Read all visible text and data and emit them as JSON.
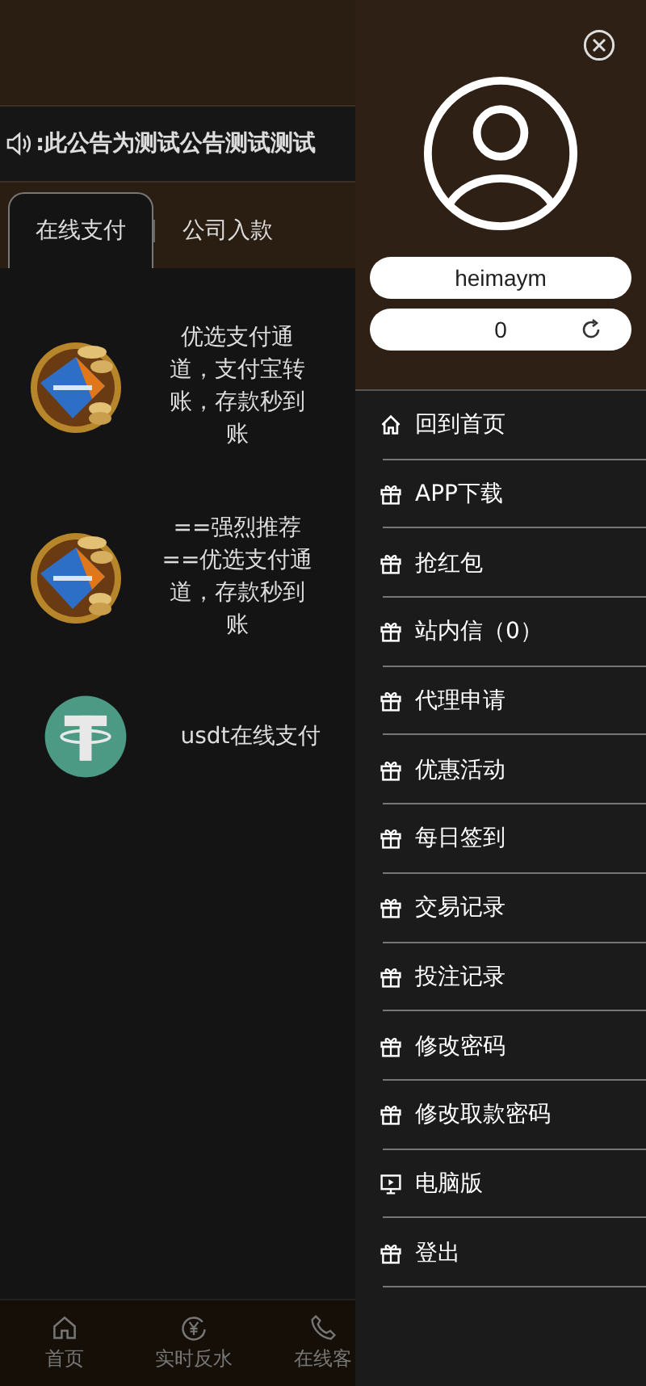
{
  "notice": {
    "text": ":此公告为测试公告测试测试"
  },
  "tabs": [
    {
      "label": "在线支付",
      "selected": true
    },
    {
      "label": "公司入款",
      "selected": false
    }
  ],
  "payments": [
    {
      "kind": "alipay",
      "label": "优选支付通道，支付宝转账，存款秒到账"
    },
    {
      "kind": "alipay",
      "label": "==强烈推荐==优选支付通道，存款秒到账"
    },
    {
      "kind": "usdt",
      "label": "usdt在线支付"
    }
  ],
  "bottom_nav": [
    {
      "kind": "home",
      "label": "首页"
    },
    {
      "kind": "yen",
      "label": "实时反水"
    },
    {
      "kind": "phone",
      "label": "在线客"
    }
  ],
  "drawer": {
    "username": "heimaym",
    "balance": "0",
    "menu": [
      {
        "kind": "home",
        "label": "回到首页"
      },
      {
        "kind": "gift",
        "label": "APP下载"
      },
      {
        "kind": "gift",
        "label": "抢红包"
      },
      {
        "kind": "gift",
        "label": "站内信（0）"
      },
      {
        "kind": "gift",
        "label": "代理申请"
      },
      {
        "kind": "gift",
        "label": "优惠活动"
      },
      {
        "kind": "gift",
        "label": "每日签到"
      },
      {
        "kind": "gift",
        "label": "交易记录"
      },
      {
        "kind": "gift",
        "label": "投注记录"
      },
      {
        "kind": "gift",
        "label": "修改密码"
      },
      {
        "kind": "gift",
        "label": "修改取款密码"
      },
      {
        "kind": "monitor",
        "label": "电脑版"
      },
      {
        "kind": "gift",
        "label": "登出"
      }
    ]
  }
}
